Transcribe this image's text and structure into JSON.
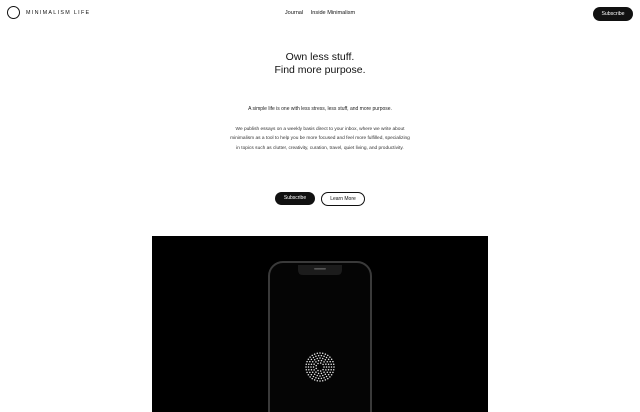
{
  "header": {
    "brand": "MINIMALISM LIFE",
    "nav": [
      "Journal",
      "Inside Minimalism"
    ],
    "subscribe_label": "Subscribe"
  },
  "hero": {
    "title_line1": "Own less stuff.",
    "title_line2": "Find more purpose.",
    "tagline": "A simple life is one with less stress, less stuff, and more purpose.",
    "description": "We publish essays on a weekly basis direct to your inbox, where we write about minimalism as a tool to help you be more focused and feel more fulfilled, specializing in topics such as clutter, creativity, curation, travel, quiet living, and productivity.",
    "primary_cta": "Subscribe",
    "secondary_cta": "Learn More"
  },
  "icons": {
    "logo": "ring-logo-icon",
    "phone_screen": "dotted-circle-icon"
  },
  "colors": {
    "ink": "#111111",
    "background": "#ffffff",
    "showcase": "#000000"
  }
}
